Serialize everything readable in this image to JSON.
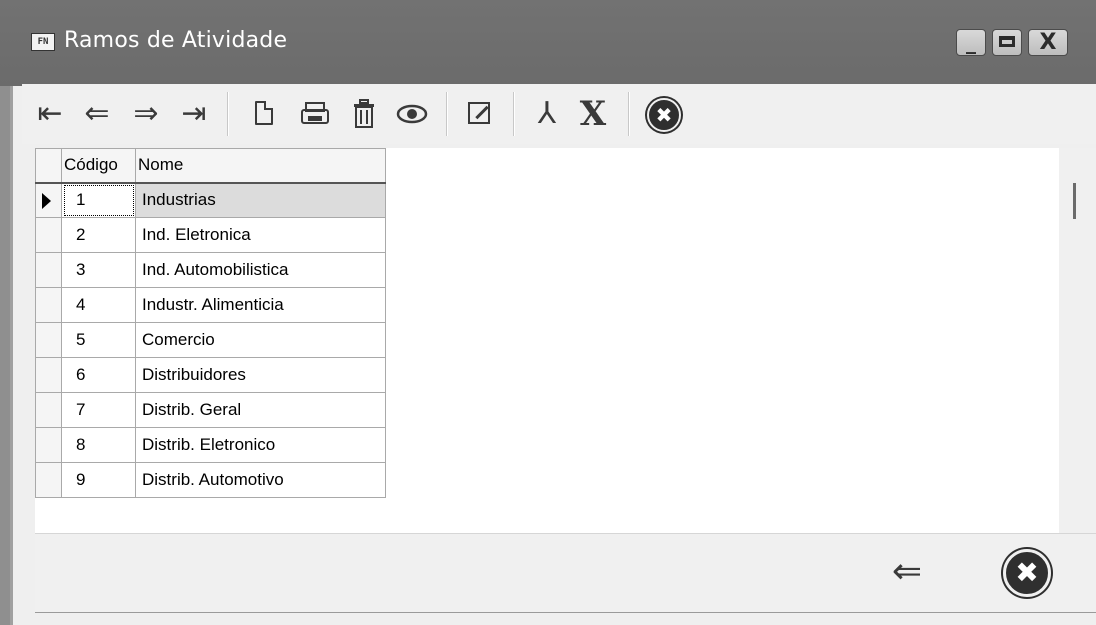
{
  "window": {
    "app_icon_text": "FN",
    "title": "Ramos de Atividade",
    "controls": {
      "minimize": "_",
      "close": "X"
    }
  },
  "toolbar": {
    "first": "⇤",
    "prev": "⇐",
    "next": "⇒",
    "last": "⇥",
    "pdf": "⅄",
    "excel": "X",
    "cancel": "✖"
  },
  "grid": {
    "columns": [
      "Código",
      "Nome"
    ],
    "selected_index": 0,
    "rows": [
      {
        "codigo": "1",
        "nome": "Industrias"
      },
      {
        "codigo": "2",
        "nome": "Ind. Eletronica"
      },
      {
        "codigo": "3",
        "nome": "Ind. Automobilistica"
      },
      {
        "codigo": "4",
        "nome": "Industr. Alimenticia"
      },
      {
        "codigo": "5",
        "nome": "Comercio"
      },
      {
        "codigo": "6",
        "nome": "Distribuidores"
      },
      {
        "codigo": "7",
        "nome": "Distrib. Geral"
      },
      {
        "codigo": "8",
        "nome": "Distrib. Eletronico"
      },
      {
        "codigo": "9",
        "nome": "Distrib. Automotivo"
      }
    ]
  },
  "footer": {
    "back": "⇐",
    "close": "✖"
  },
  "icons": {
    "first": "first-record-icon",
    "prev": "previous-record-icon",
    "next": "next-record-icon",
    "last": "last-record-icon",
    "new": "new-document-icon",
    "print": "printer-icon",
    "delete": "trash-icon",
    "view": "eye-icon",
    "edit": "edit-icon",
    "pdf": "pdf-icon",
    "excel": "excel-icon",
    "cancel": "cancel-circle-icon"
  },
  "colors": {
    "titlebar": "#6e6e6e",
    "selected_row": "#dcdcdc",
    "toolbar_bg": "#f0f0f0"
  }
}
